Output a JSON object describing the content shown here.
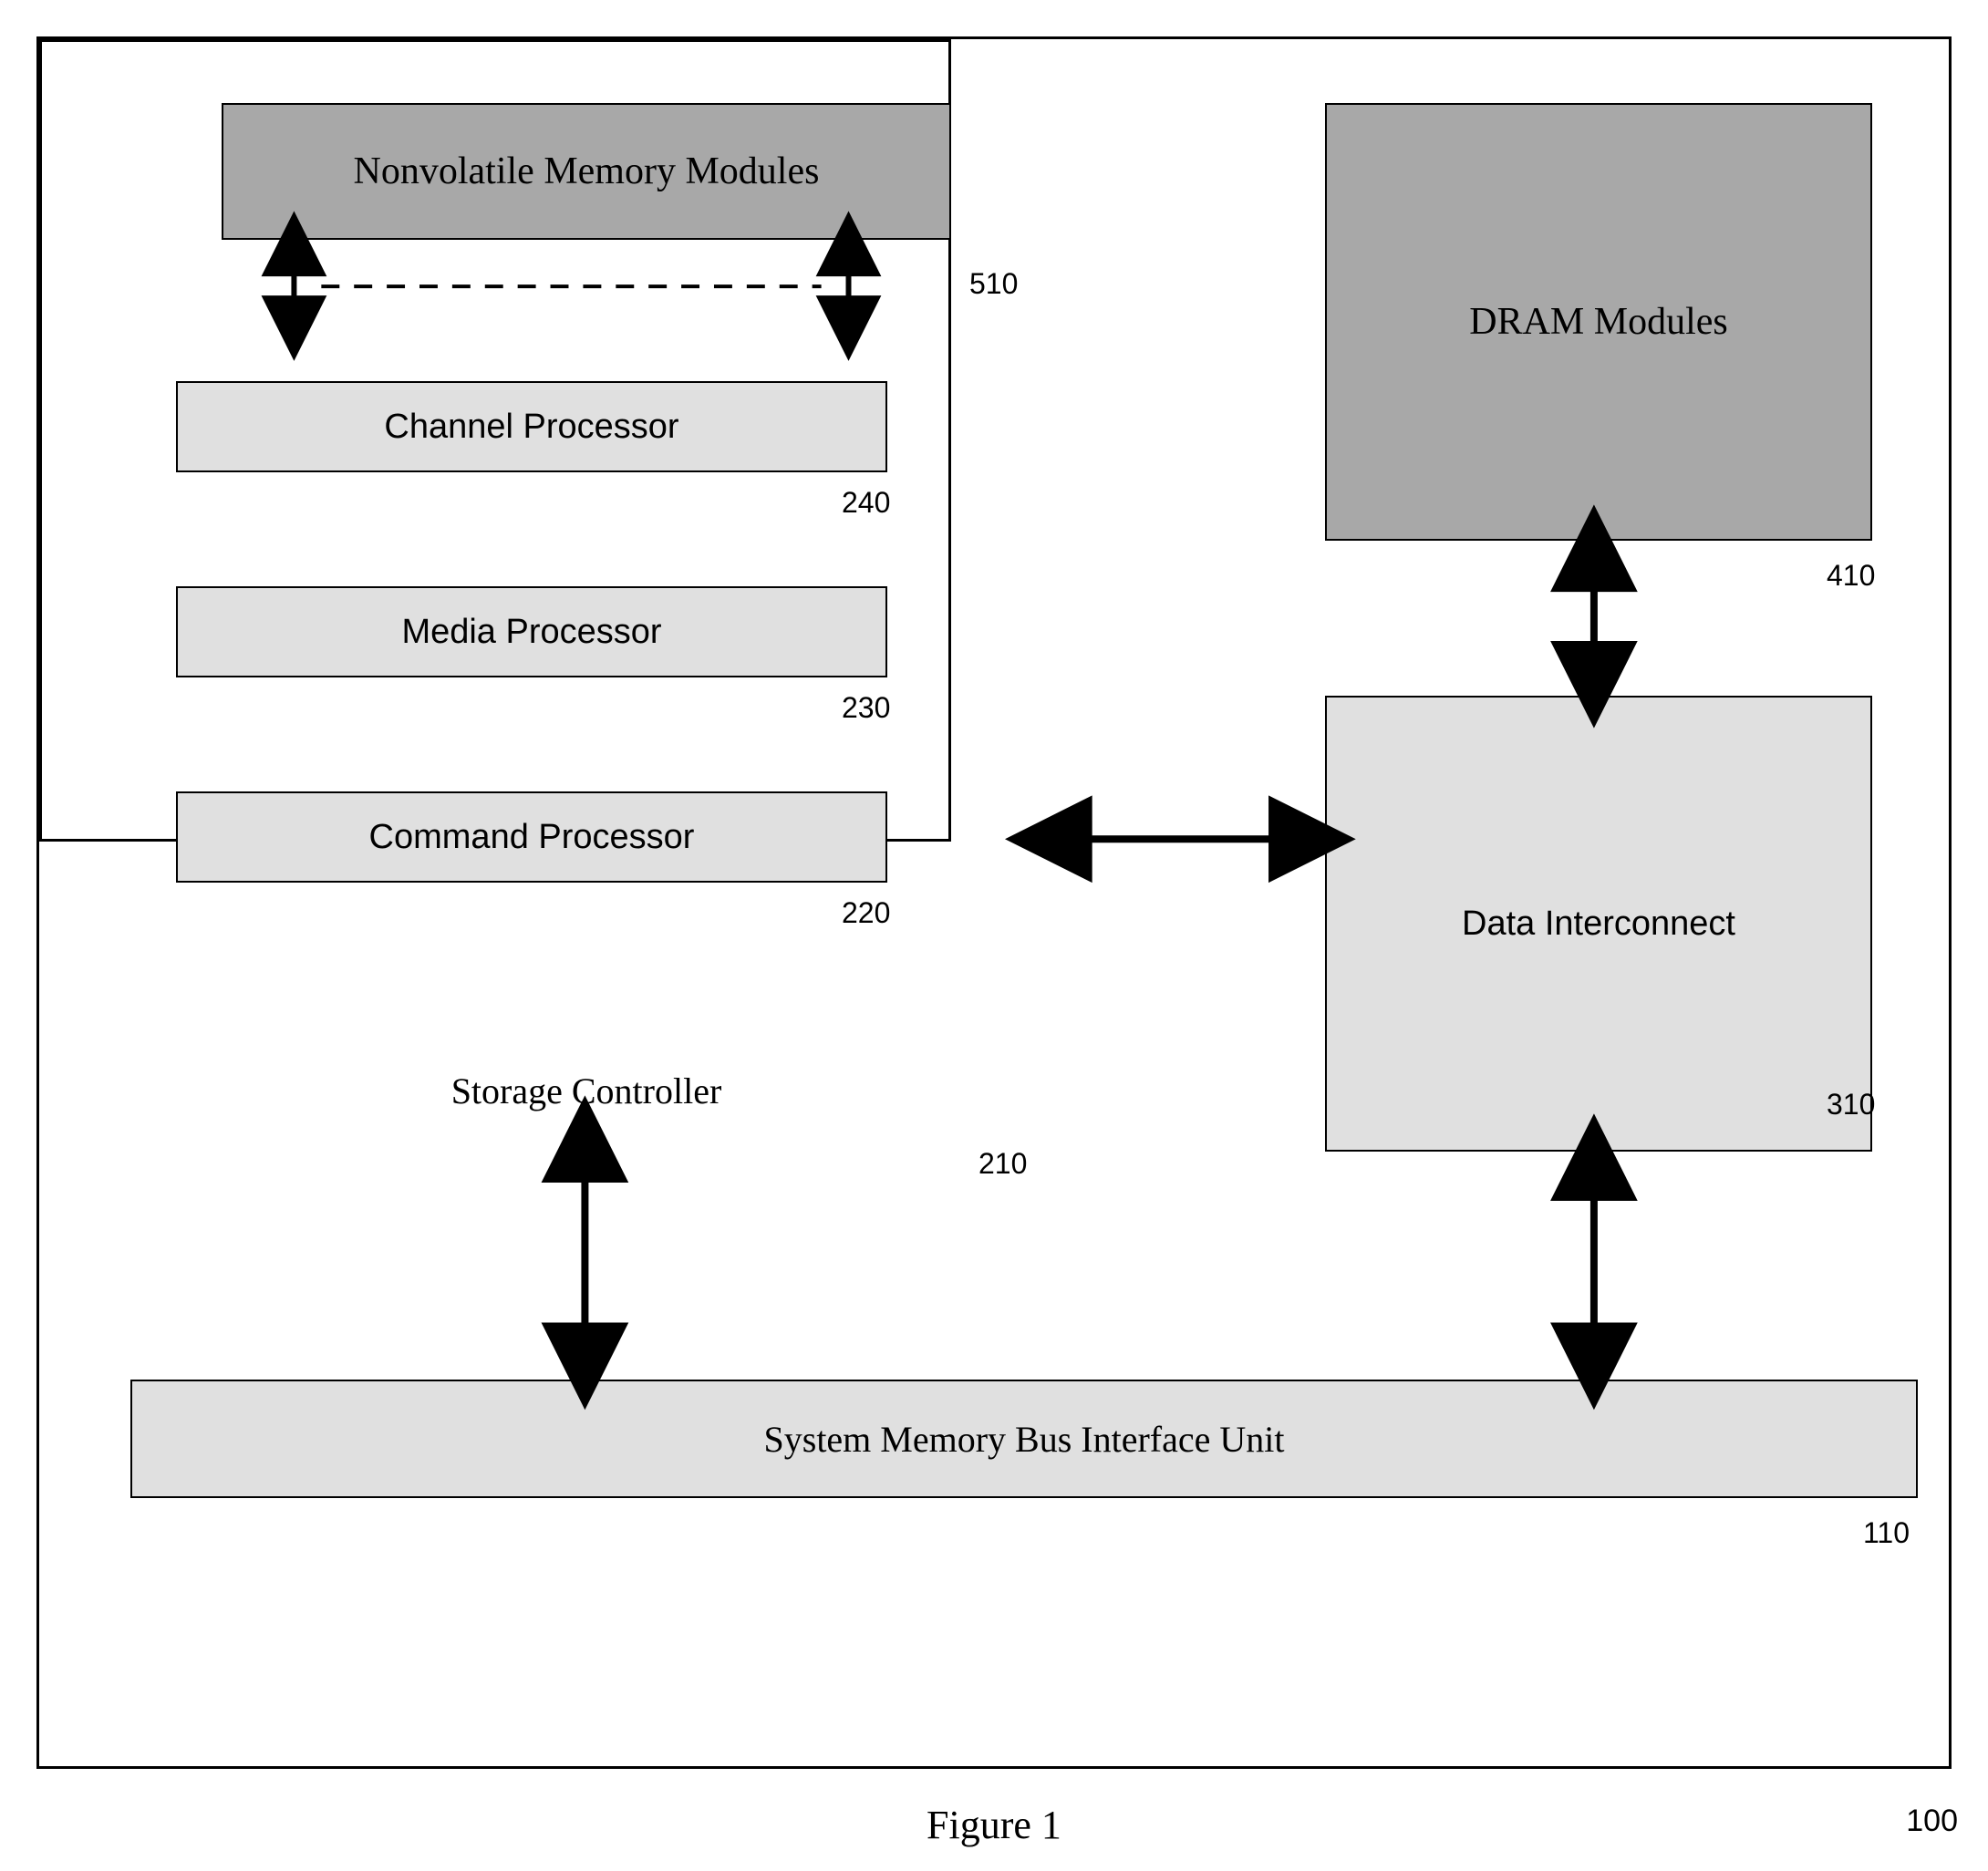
{
  "blocks": {
    "nvm": {
      "label": "Nonvolatile  Memory Modules",
      "ref": "510"
    },
    "dram": {
      "label": "DRAM Modules",
      "ref": "410"
    },
    "storage_controller": {
      "label": "Storage Controller",
      "ref": "210"
    },
    "channel_proc": {
      "label": "Channel Processor",
      "ref": "240"
    },
    "media_proc": {
      "label": "Media Processor",
      "ref": "230"
    },
    "command_proc": {
      "label": "Command Processor",
      "ref": "220"
    },
    "data_interconnect": {
      "label": "Data Interconnect",
      "ref": "310"
    },
    "bus_interface": {
      "label": "System Memory Bus Interface Unit",
      "ref": "110"
    }
  },
  "figure": {
    "caption": "Figure 1",
    "ref": "100"
  },
  "connections": [
    {
      "from": "nvm",
      "to": "storage_controller",
      "style": "dashed-multi-bidir"
    },
    {
      "from": "storage_controller",
      "to": "data_interconnect",
      "style": "bidir"
    },
    {
      "from": "storage_controller",
      "to": "bus_interface",
      "style": "bidir"
    },
    {
      "from": "dram",
      "to": "data_interconnect",
      "style": "bidir"
    },
    {
      "from": "data_interconnect",
      "to": "bus_interface",
      "style": "bidir"
    }
  ]
}
